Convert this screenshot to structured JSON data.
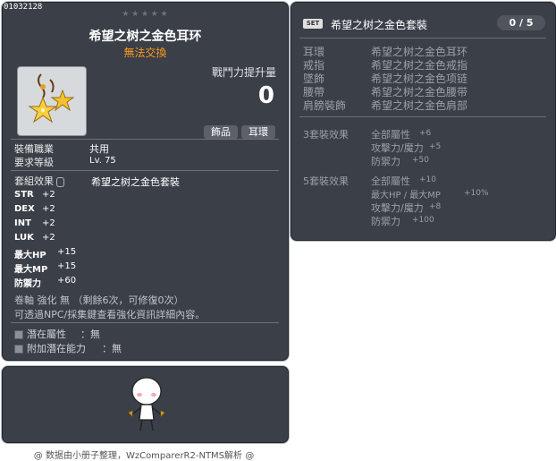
{
  "item": {
    "id": "01032128",
    "star_count": 5,
    "name": "希望之树之金色耳环",
    "trade": "無法交換",
    "icon": "golden-star-earring-icon",
    "power_label": "戰鬥力提升量",
    "power_value": "0",
    "tags": [
      "飾品",
      "耳環"
    ],
    "requirements": [
      {
        "label": "裝備職業",
        "value": "共用"
      },
      {
        "label": "要求等級",
        "value": "Lv. 75"
      }
    ],
    "set_effect_label": "套組效果",
    "set_name": "希望之树之金色套裝",
    "stats": [
      {
        "label": "STR",
        "value": "+2"
      },
      {
        "label": "DEX",
        "value": "+2"
      },
      {
        "label": "INT",
        "value": "+2"
      },
      {
        "label": "LUK",
        "value": "+2"
      },
      {
        "label": "最大HP",
        "value": "+15"
      },
      {
        "label": "最大MP",
        "value": "+15"
      },
      {
        "label": "防禦力",
        "value": "+60"
      }
    ],
    "scroll_info": "卷軸 強化 無 （剩餘6次，可修復0次）",
    "hint": "可透過NPC/採集鍵查看強化資訊詳細內容。",
    "potentials": [
      {
        "label": "潛在屬性",
        "value": "：無"
      },
      {
        "label": "附加潛在能力",
        "value": "：無"
      }
    ]
  },
  "set": {
    "badge": "SET",
    "title": "希望之树之金色套裝",
    "count": "0 / 5",
    "parts": [
      {
        "type": "耳環",
        "name": "希望之树之金色耳环"
      },
      {
        "type": "戒指",
        "name": "希望之树之金色戒指"
      },
      {
        "type": "墜飾",
        "name": "希望之树之金色项链"
      },
      {
        "type": "腰帶",
        "name": "希望之树之金色腰带"
      },
      {
        "type": "肩膀裝飾",
        "name": "希望之树之金色肩部"
      }
    ],
    "effects": [
      {
        "head": "3套裝效果",
        "lines": [
          {
            "name": "全部屬性",
            "value": "+6"
          },
          {
            "name": "攻擊力/魔力",
            "value": "+5"
          },
          {
            "name": "防禦力",
            "value": "+50"
          }
        ]
      },
      {
        "head": "5套裝效果",
        "lines": [
          {
            "name": "全部屬性",
            "value": "+10"
          },
          {
            "name": "最大HP / 最大MP",
            "value": "+10%"
          },
          {
            "name": "攻擊力/魔力",
            "value": "+8"
          },
          {
            "name": "防禦力",
            "value": "+100"
          }
        ]
      }
    ]
  },
  "footer": "@ 数据由小册子整理，WzComparerR2-NTMS解析 @",
  "colors": {
    "panel_bg": "#3a3f48",
    "trade_orange": "#ff9a1a",
    "dim_text": "#9aa0a8"
  }
}
